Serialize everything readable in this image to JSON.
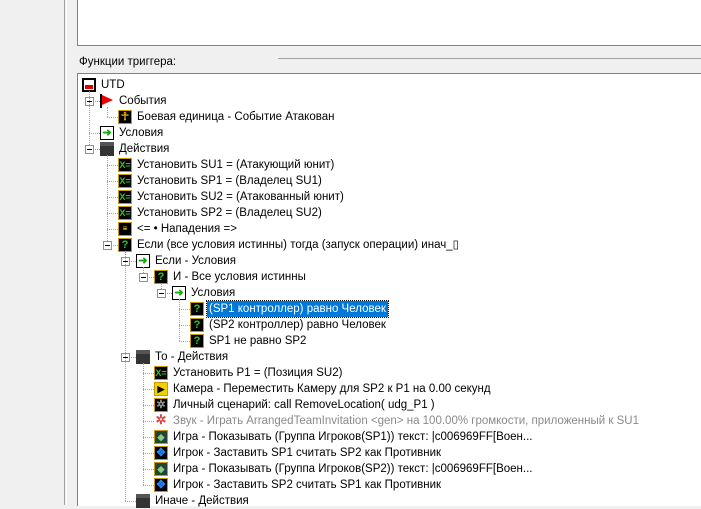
{
  "section_label": "Функции триггера:",
  "tree": [
    {
      "level": 0,
      "text": "UTD",
      "icon": "trigger-doc-icon",
      "cls": "i-doc",
      "glyph": ""
    },
    {
      "level": 1,
      "text": "События",
      "icon": "events-flag-icon",
      "cls": "i-flag",
      "glyph": "",
      "expanded": true
    },
    {
      "level": 2,
      "text": "Боевая единица - Событие Атакован",
      "icon": "unit-event-icon",
      "cls": "i-unit",
      "glyph": "☥"
    },
    {
      "level": 1,
      "text": "Условия",
      "icon": "conditions-icon",
      "cls": "i-cond",
      "glyph": "➜"
    },
    {
      "level": 1,
      "text": "Действия",
      "icon": "actions-clapper-icon",
      "cls": "i-act",
      "glyph": "",
      "expanded": true
    },
    {
      "level": 2,
      "text": "Установить SU1 = (Атакующий юнит)",
      "icon": "set-variable-icon",
      "cls": "i-set",
      "glyph": "X="
    },
    {
      "level": 2,
      "text": "Установить SP1 = (Владелец SU1)",
      "icon": "set-variable-icon",
      "cls": "i-set",
      "glyph": "X="
    },
    {
      "level": 2,
      "text": "Установить SU2 = (Атакованный юнит)",
      "icon": "set-variable-icon",
      "cls": "i-set",
      "glyph": "X="
    },
    {
      "level": 2,
      "text": "Установить SP2 = (Владелец SU2)",
      "icon": "set-variable-icon",
      "cls": "i-set",
      "glyph": "X="
    },
    {
      "level": 2,
      "text": "<= • Нападения =>",
      "icon": "comment-icon",
      "cls": "i-cmt",
      "glyph": "≡"
    },
    {
      "level": 2,
      "text": "Если (все условия истинны) тогда (запуск операции) инач_▯",
      "icon": "if-question-icon",
      "cls": "i-q",
      "glyph": "?",
      "expanded": true
    },
    {
      "level": 3,
      "text": "Если - Условия",
      "icon": "conditions-icon",
      "cls": "i-cond",
      "glyph": "➜",
      "expanded": true
    },
    {
      "level": 4,
      "text": "И - Все условия истинны",
      "icon": "and-question-icon",
      "cls": "i-q",
      "glyph": "?",
      "expanded": true
    },
    {
      "level": 5,
      "text": "Условия",
      "icon": "conditions-icon",
      "cls": "i-cond",
      "glyph": "➜",
      "expanded": true
    },
    {
      "level": 6,
      "text": "(SP1 контроллер) равно Человек",
      "icon": "condition-question-icon",
      "cls": "i-q",
      "glyph": "?",
      "selected": true
    },
    {
      "level": 6,
      "text": "(SP2 контроллер) равно Человек",
      "icon": "condition-question-icon",
      "cls": "i-q",
      "glyph": "?"
    },
    {
      "level": 6,
      "text": "SP1 не равно SP2",
      "icon": "condition-question-icon",
      "cls": "i-q",
      "glyph": "?"
    },
    {
      "level": 3,
      "text": "То - Действия",
      "icon": "actions-clapper-icon",
      "cls": "i-act",
      "glyph": "",
      "expanded": true
    },
    {
      "level": 4,
      "text": "Установить P1 = (Позиция SU2)",
      "icon": "set-variable-icon",
      "cls": "i-set",
      "glyph": "X="
    },
    {
      "level": 4,
      "text": "Камера - Переместить Камеру для SP2 к P1 на 0.00 секунд",
      "icon": "camera-icon",
      "cls": "i-cam",
      "glyph": "▶"
    },
    {
      "level": 4,
      "text": "Личный сценарий: call RemoveLocation( udg_P1 )",
      "icon": "gear-icon",
      "cls": "i-gear",
      "glyph": "✲"
    },
    {
      "level": 4,
      "text": "Звук - Играть ArrangedTeamInvitation <gen> на 100.00% громкости, приложенный к SU1",
      "icon": "sound-gear-icon",
      "cls": "i-gear-r",
      "glyph": "✲",
      "disabled": true
    },
    {
      "level": 4,
      "text": "Игра - Показывать (Группа Игроков(SP1)) текст: |c006969FF[Воен...",
      "icon": "game-icon",
      "cls": "i-game",
      "glyph": "◆"
    },
    {
      "level": 4,
      "text": "Игрок - Заставить SP1 считать SP2 как Противник",
      "icon": "player-icon",
      "cls": "i-player",
      "glyph": "✥"
    },
    {
      "level": 4,
      "text": "Игра - Показывать (Группа Игроков(SP2)) текст: |c006969FF[Воен...",
      "icon": "game-icon",
      "cls": "i-game",
      "glyph": "◆"
    },
    {
      "level": 4,
      "text": "Игрок - Заставить SP2 считать SP1 как Противник",
      "icon": "player-icon",
      "cls": "i-player",
      "glyph": "✥"
    },
    {
      "level": 3,
      "text": "Иначе - Действия",
      "icon": "actions-clapper-icon",
      "cls": "i-act",
      "glyph": ""
    }
  ]
}
